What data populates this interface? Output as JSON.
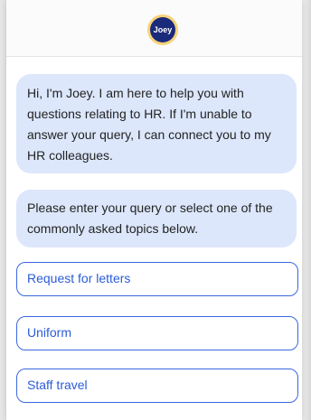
{
  "header": {
    "logo_text": "Joey"
  },
  "messages": [
    {
      "text": "Hi, I'm Joey. I am here to help you with questions relating to HR. If I'm unable to answer your query, I can connect you to my HR colleagues."
    },
    {
      "text": "Please enter your query or select one of the commonly asked topics below."
    }
  ],
  "options": [
    {
      "label": "Request for letters"
    },
    {
      "label": "Uniform"
    },
    {
      "label": "Staff travel"
    }
  ],
  "colors": {
    "bubble_bg": "#dce7fb",
    "option_accent": "#2a5bd8",
    "logo_bg": "#1b2a7a",
    "logo_ring": "#f6d37a"
  }
}
